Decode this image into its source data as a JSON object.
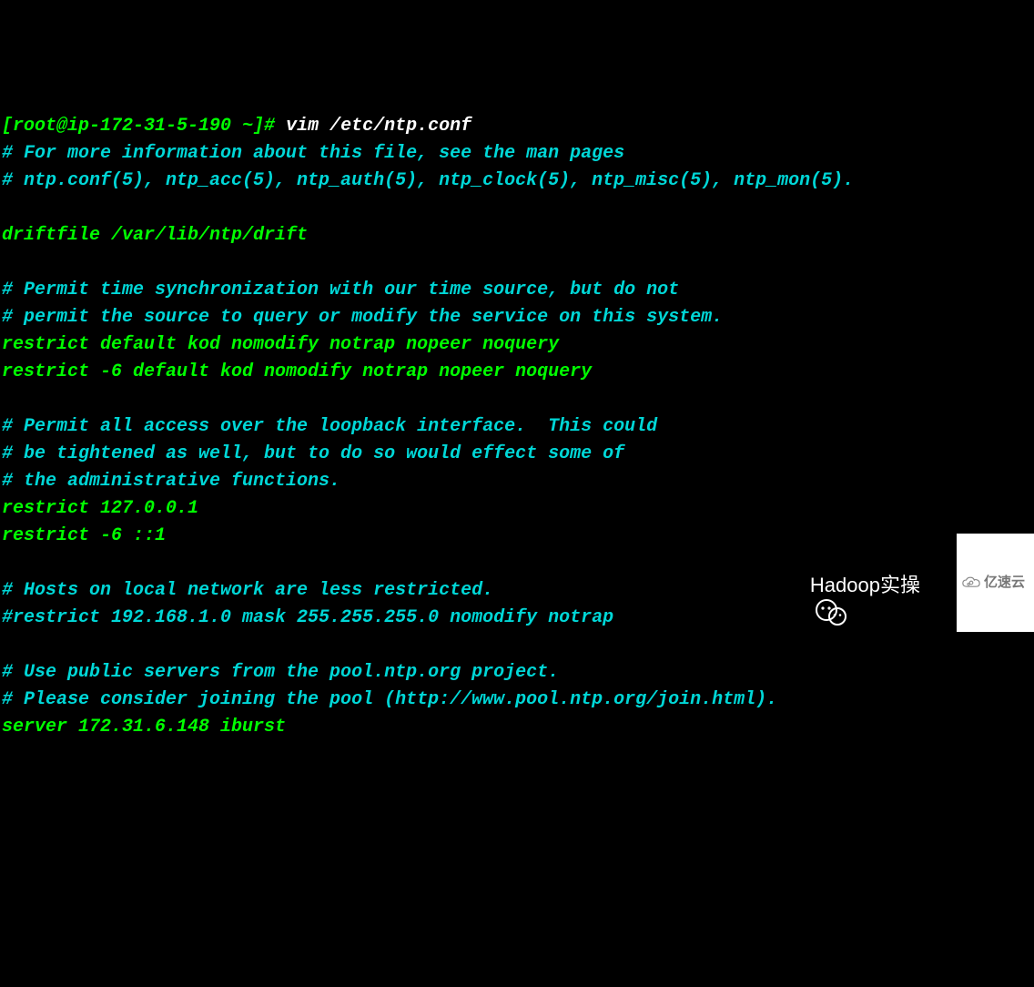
{
  "prompt": "[root@ip-172-31-5-190 ~]# ",
  "command": "vim /etc/ntp.conf",
  "lines": [
    {
      "cls": "comment",
      "text": "# For more information about this file, see the man pages"
    },
    {
      "cls": "comment",
      "text": "# ntp.conf(5), ntp_acc(5), ntp_auth(5), ntp_clock(5), ntp_misc(5), ntp_mon(5)."
    },
    {
      "cls": "",
      "text": ""
    },
    {
      "cls": "directive",
      "text": "driftfile /var/lib/ntp/drift"
    },
    {
      "cls": "",
      "text": ""
    },
    {
      "cls": "comment",
      "text": "# Permit time synchronization with our time source, but do not"
    },
    {
      "cls": "comment",
      "text": "# permit the source to query or modify the service on this system."
    },
    {
      "cls": "directive",
      "text": "restrict default kod nomodify notrap nopeer noquery"
    },
    {
      "cls": "directive",
      "text": "restrict -6 default kod nomodify notrap nopeer noquery"
    },
    {
      "cls": "",
      "text": ""
    },
    {
      "cls": "comment",
      "text": "# Permit all access over the loopback interface.  This could"
    },
    {
      "cls": "comment",
      "text": "# be tightened as well, but to do so would effect some of"
    },
    {
      "cls": "comment",
      "text": "# the administrative functions."
    },
    {
      "cls": "directive",
      "text": "restrict 127.0.0.1"
    },
    {
      "cls": "directive",
      "text": "restrict -6 ::1"
    },
    {
      "cls": "",
      "text": ""
    },
    {
      "cls": "comment",
      "text": "# Hosts on local network are less restricted."
    },
    {
      "cls": "comment",
      "text": "#restrict 192.168.1.0 mask 255.255.255.0 nomodify notrap"
    },
    {
      "cls": "",
      "text": ""
    },
    {
      "cls": "comment",
      "text": "# Use public servers from the pool.ntp.org project."
    },
    {
      "cls": "comment",
      "text": "# Please consider joining the pool (http://www.pool.ntp.org/join.html)."
    },
    {
      "cls": "directive",
      "text": "server 172.31.6.148 iburst"
    }
  ],
  "watermark1": "Hadoop实操",
  "watermark2": "亿速云"
}
